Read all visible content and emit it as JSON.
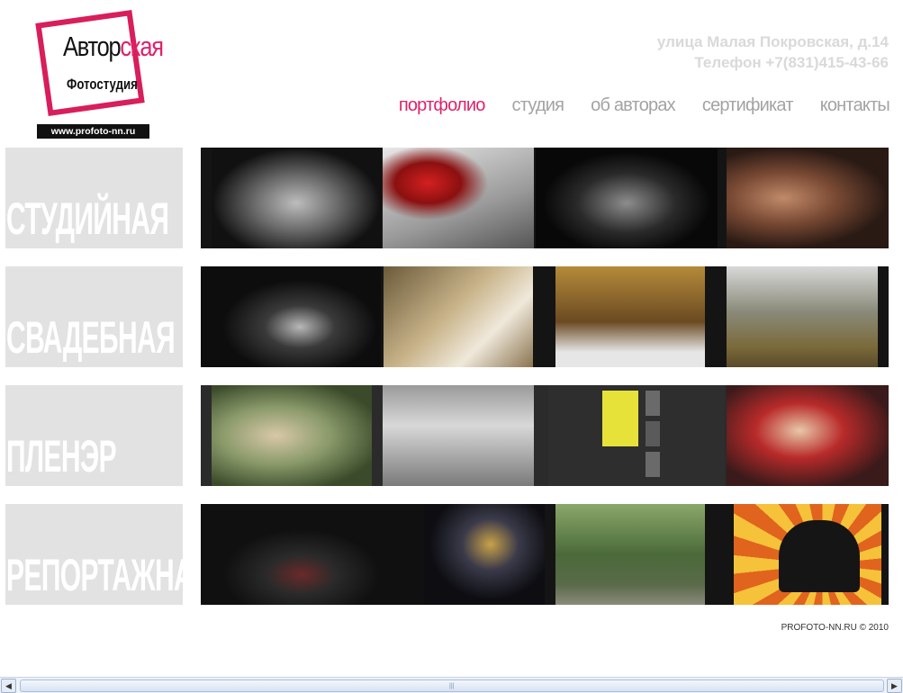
{
  "logo": {
    "word_dark": "Автор",
    "word_pink": "ская",
    "subtitle": "Фотостудия",
    "url": "www.profoto-nn.ru",
    "accent": "#e0226a"
  },
  "contact": {
    "address": "улица Малая Покровская, д.14",
    "phone": "Телефон +7(831)415-43-66"
  },
  "nav": [
    {
      "label": "портфолио",
      "active": true
    },
    {
      "label": "студия",
      "active": false
    },
    {
      "label": "об авторах",
      "active": false
    },
    {
      "label": "сертификат",
      "active": false
    },
    {
      "label": "контакты",
      "active": false
    }
  ],
  "rows": [
    {
      "category": "СТУДИЙНАЯ"
    },
    {
      "category": "СВАДЕБНАЯ"
    },
    {
      "category": "ПЛЕНЭР"
    },
    {
      "category": "РЕПОРТАЖНАЯ"
    }
  ],
  "footer": {
    "copyright": "PROFOTO-NN.RU © 2010"
  },
  "scrollbar": {
    "left_arrow": "◀",
    "right_arrow": "▶",
    "grip": "|||"
  }
}
